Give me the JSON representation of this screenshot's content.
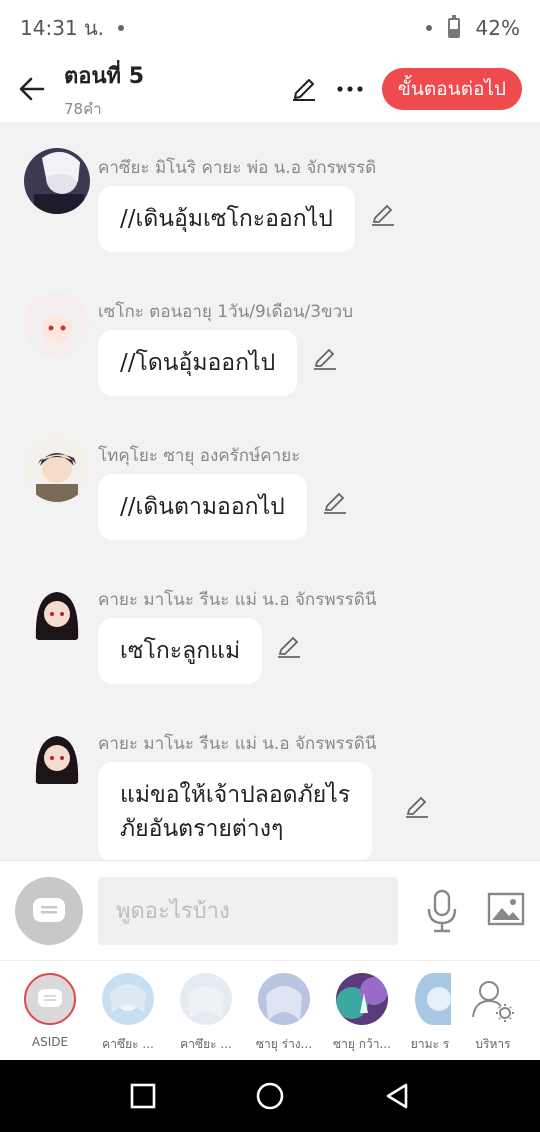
{
  "status": {
    "time": "14:31 น.",
    "battery": "42%"
  },
  "header": {
    "title": "ตอนที่ 5",
    "subtitle": "78คำ",
    "next_label": "ขั้นตอนต่อไป"
  },
  "messages": [
    {
      "name": "คาซึยะ มิโนริ คายะ พ่อ น.อ จักรพรรดิ",
      "text": "//เดินอุ้มเซโกะออกไป"
    },
    {
      "name": "เซโกะ ตอนอายุ 1วัน/9เดือน/3ขวบ",
      "text": "//โดนอุ้มออกไป"
    },
    {
      "name": "โทคุโยะ ซายุ องครักษ์คายะ",
      "text": "//เดินตามออกไป"
    },
    {
      "name": "คายะ มาโนะ รีนะ แม่ น.อ จักรพรรดินี",
      "text": "เซโกะลูกแม่"
    },
    {
      "name": "คายะ มาโนะ รีนะ แม่ น.อ จักรพรรดินี",
      "text": "แม่ขอให้เจ้าปลอดภัยไร\nภัยอันตรายต่างๆ"
    }
  ],
  "input": {
    "placeholder": "พูดอะไรบ้าง"
  },
  "characters": [
    {
      "label": "ASIDE"
    },
    {
      "label": "คาซึยะ ..."
    },
    {
      "label": "คาซึยะ ..."
    },
    {
      "label": "ซายุ ร่าง..."
    },
    {
      "label": "ซายุ กว้า..."
    },
    {
      "label": "ยามะ ร"
    },
    {
      "label": "บริหาร"
    }
  ],
  "colors": {
    "accent": "#ef4a4e",
    "background": "#f2f2f2",
    "bubble": "#ffffff"
  }
}
